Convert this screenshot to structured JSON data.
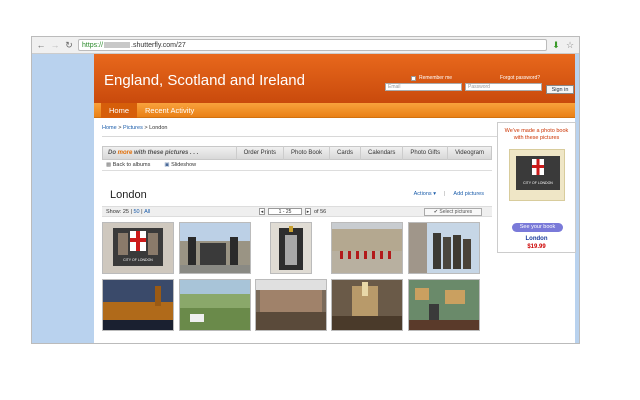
{
  "browser": {
    "url_scheme": "https://",
    "url_rest": ".shutterfly.com/27"
  },
  "site": {
    "title": "England, Scotland and Ireland",
    "remember_me": "Remember me",
    "forgot_password": "Forgot password?",
    "email_placeholder": "Email",
    "password_placeholder": "Password",
    "sign_in": "Sign in"
  },
  "nav": {
    "tabs": [
      {
        "label": "Home"
      },
      {
        "label": "Recent Activity"
      }
    ]
  },
  "breadcrumb": {
    "home": "Home",
    "sep": ">",
    "pictures": "Pictures",
    "current": "London"
  },
  "album": {
    "do_more_prefix": "Do",
    "do_more_em": "more",
    "do_more_suffix": "with these pictures . . .",
    "actions": [
      "Order Prints",
      "Photo Book",
      "Cards",
      "Calendars",
      "Photo Gifts",
      "Videogram"
    ],
    "back_to_albums": "Back to albums",
    "slideshow": "Slideshow",
    "title": "London",
    "actions_menu": "Actions",
    "add_pictures": "Add pictures",
    "show_label": "Show:",
    "show_25": "25",
    "show_50": "50",
    "show_all": "All",
    "page_range": "1 - 25",
    "of_total": "of 56",
    "select_pictures": "Select pictures"
  },
  "promo": {
    "text": "We've made a photo book with these pictures",
    "book_caption": "CITY OF LONDON",
    "button": "See your book",
    "name": "London",
    "price": "$19.99"
  },
  "thumbs": [
    {
      "caption": "CITY OF LONDON"
    },
    {
      "caption": ""
    },
    {
      "caption": ""
    },
    {
      "caption": ""
    },
    {
      "caption": ""
    },
    {
      "caption": ""
    },
    {
      "caption": ""
    },
    {
      "caption": ""
    },
    {
      "caption": ""
    },
    {
      "caption": ""
    }
  ],
  "colors": {
    "header_orange": "#d9580f",
    "nav_orange": "#f08a20",
    "link_blue": "#1a5caa",
    "side_blue": "#b9d2ee",
    "price_red": "#cc0000"
  },
  "icons": {
    "back": "arrow-left-icon",
    "forward": "arrow-right-icon",
    "reload": "reload-icon",
    "download": "download-arrow-icon",
    "star": "star-icon"
  }
}
